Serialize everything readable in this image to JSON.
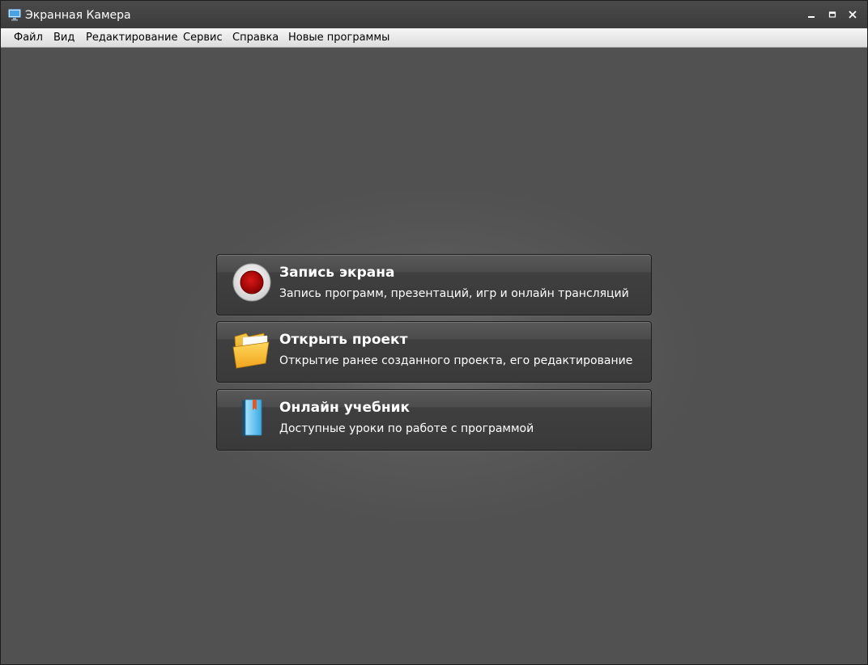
{
  "window": {
    "title": "Экранная Камера",
    "app_icon": "monitor-icon",
    "controls": [
      "minimize-icon",
      "maximize-icon",
      "close-icon"
    ]
  },
  "menu": {
    "items": [
      {
        "label": "Файл"
      },
      {
        "label": "Вид"
      },
      {
        "label": "Редактирование"
      },
      {
        "label": "Сервис"
      },
      {
        "label": "Справка"
      },
      {
        "label": "Новые программы"
      }
    ]
  },
  "actions": [
    {
      "title": "Запись экрана",
      "description": "Запись программ, презентаций, игр и онлайн трансляций",
      "icon": "record-icon"
    },
    {
      "title": "Открыть проект",
      "description": "Открытие ранее созданного проекта, его редактирование",
      "icon": "folder-icon"
    },
    {
      "title": "Онлайн учебник",
      "description": "Доступные уроки по работе с программой",
      "icon": "book-icon"
    }
  ],
  "colors": {
    "record_red": "#b30000",
    "folder_yellow": "#f5b21a",
    "book_blue": "#3aa8e0",
    "bookmark_orange": "#e0592a"
  }
}
